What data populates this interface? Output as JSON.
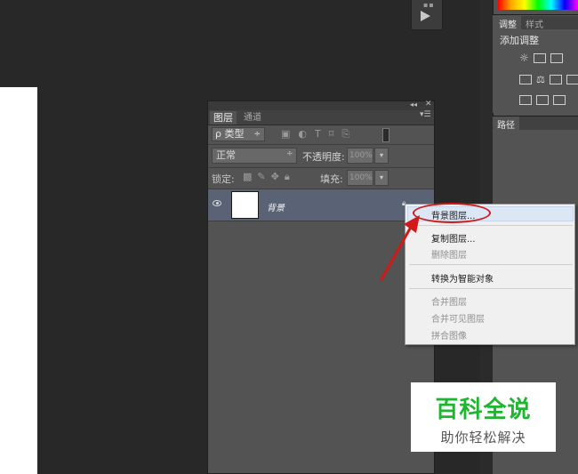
{
  "adjustments_panel": {
    "tabs": [
      "调整",
      "样式"
    ],
    "title": "添加调整"
  },
  "paths_panel": {
    "tab": "路径"
  },
  "layers_panel": {
    "tab_layers": "图层",
    "tab_channels": "通道",
    "filter_label": "ρ 类型",
    "filter_arrow": "÷",
    "blend_mode": "正常",
    "blend_arrow": "÷",
    "opacity_label": "不透明度:",
    "opacity_value": "100%",
    "lock_label": "锁定:",
    "fill_label": "填充:",
    "fill_value": "100%",
    "layer": {
      "name": "背景"
    }
  },
  "context_menu": {
    "items": [
      {
        "label": "背景图层...",
        "enabled": true
      },
      {
        "label": "复制图层...",
        "enabled": true
      },
      {
        "label": "删除图层",
        "enabled": false
      },
      {
        "label": "转换为智能对象",
        "enabled": true
      },
      {
        "label": "合并图层",
        "enabled": false
      },
      {
        "label": "合并可见图层",
        "enabled": false
      },
      {
        "label": "拼合图像",
        "enabled": false
      }
    ]
  },
  "watermark": {
    "title": "百科全说",
    "subtitle": "助你轻松解决"
  },
  "colors": {
    "annotation_red": "#d21919",
    "watermark_green": "#1fb62f",
    "selected_layer_bg": "#596375"
  }
}
